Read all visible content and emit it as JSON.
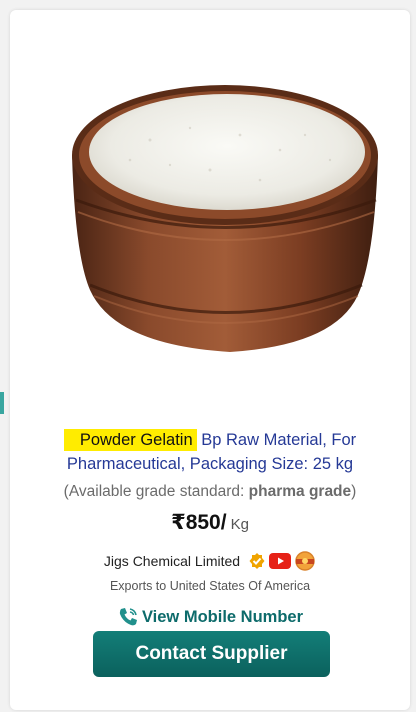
{
  "product": {
    "title_highlight": "Powder Gelatin",
    "title_rest": "Bp Raw Material, For Pharmaceutical, Packaging Size: 25 kg",
    "grade_prefix": "(Available grade standard: ",
    "grade_value": "pharma grade",
    "grade_suffix": ")",
    "price": "₹850/",
    "unit": "Kg",
    "image_icon": "gelatin-powder-bowl-image"
  },
  "supplier": {
    "name": "Jigs Chemical Limited",
    "exports": "Exports to United States Of America",
    "badges": [
      "verified-badge-icon",
      "youtube-icon",
      "leading-supplier-badge-icon"
    ]
  },
  "actions": {
    "view_mobile": "View Mobile Number",
    "contact": "Contact Supplier"
  },
  "colors": {
    "accent": "#0d6b6b",
    "button": "#137e78",
    "highlight": "#ffec00",
    "title_link": "#253996"
  }
}
